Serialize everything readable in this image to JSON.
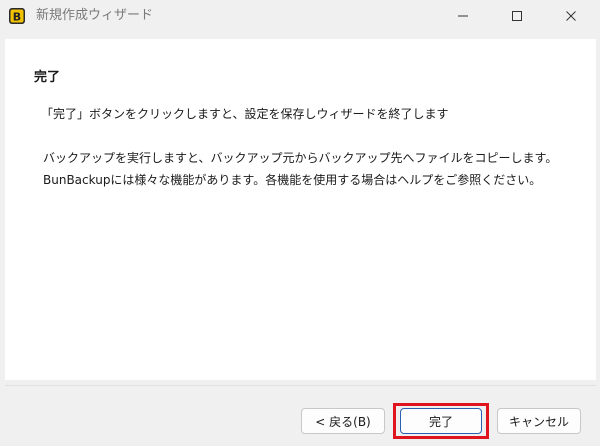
{
  "window": {
    "title": "新規作成ウィザード",
    "icon": "bunbackup-app-icon"
  },
  "content": {
    "heading": "完了",
    "line1": "「完了」ボタンをクリックしますと、設定を保存しウィザードを終了します",
    "line2": "バックアップを実行しますと、バックアップ元からバックアップ先へファイルをコピーします。",
    "line3": "BunBackupには様々な機能があります。各機能を使用する場合はヘルプをご参照ください。"
  },
  "buttons": {
    "back": "< 戻る(B)",
    "finish": "完了",
    "cancel": "キャンセル"
  },
  "colors": {
    "highlight": "#e0141e",
    "focus_border": "#2b5fb3"
  }
}
